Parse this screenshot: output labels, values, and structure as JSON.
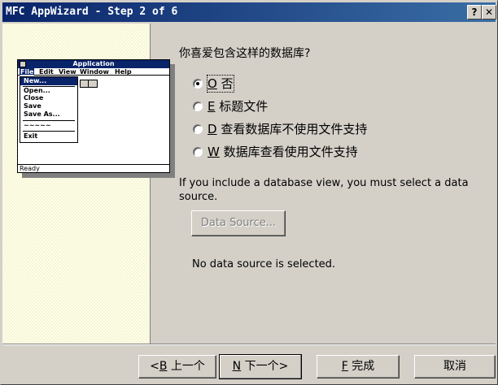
{
  "window": {
    "title": "MFC AppWizard - Step 2 of 6",
    "help_button": "?",
    "close_button": "✕"
  },
  "illustration": {
    "app_title": "Application",
    "menubar": [
      "File",
      "Edit",
      "View",
      "Window",
      "Help"
    ],
    "file_menu": [
      "New...",
      "Open...",
      "Close",
      "Save",
      "Save As...",
      "~~~~~",
      "Exit"
    ],
    "status": "Ready"
  },
  "question": "你喜爱包含这样的数据库?",
  "options": [
    {
      "key": "O",
      "label": "否",
      "selected": true
    },
    {
      "key": "E",
      "label": "标题文件",
      "selected": false
    },
    {
      "key": "D",
      "label": "查看数据库不使用文件支持",
      "selected": false
    },
    {
      "key": "W",
      "label": "数据库查看使用文件支持",
      "selected": false
    }
  ],
  "info_text": "If you include a database view, you must select a data source.",
  "data_source_button": "Data Source...",
  "data_source_status": "No data source is selected.",
  "buttons": {
    "back_prefix": "<",
    "back_key": "B",
    "back_label": "上一个",
    "next_key": "N",
    "next_label": "下一个>",
    "finish_key": "F",
    "finish_label": "完成",
    "cancel_label": "取消"
  }
}
